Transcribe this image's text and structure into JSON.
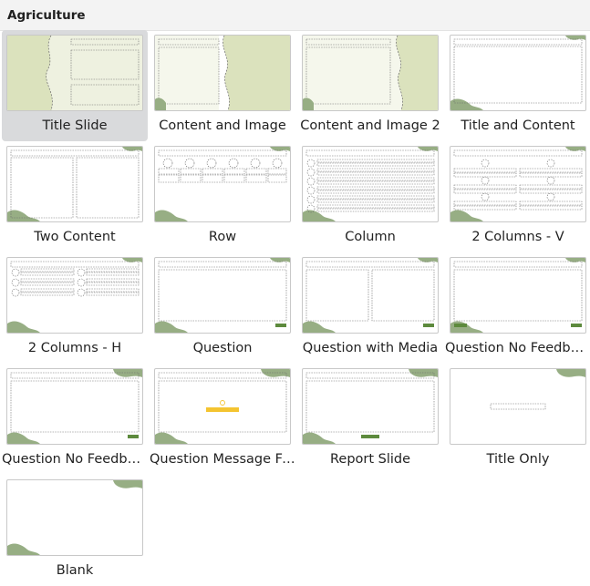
{
  "header": {
    "title": "Agriculture"
  },
  "colors": {
    "accent_green": "#97ae84",
    "pale_green": "#dbe2bd",
    "dark_green": "#5d8a3d",
    "highlight_yellow": "#f4c430",
    "selected_bg": "#d9dadc"
  },
  "layouts": [
    {
      "label": "Title Slide",
      "selected": true
    },
    {
      "label": "Content and Image",
      "selected": false
    },
    {
      "label": "Content and Image 2",
      "selected": false
    },
    {
      "label": "Title and Content",
      "selected": false
    },
    {
      "label": "Two Content",
      "selected": false
    },
    {
      "label": "Row",
      "selected": false
    },
    {
      "label": "Column",
      "selected": false
    },
    {
      "label": "2 Columns - V",
      "selected": false
    },
    {
      "label": "2 Columns - H",
      "selected": false
    },
    {
      "label": "Question",
      "selected": false
    },
    {
      "label": "Question with Media",
      "selected": false
    },
    {
      "label": "Question No Feedba…",
      "selected": false
    },
    {
      "label": "Question No Feedba…",
      "selected": false
    },
    {
      "label": "Question Message Fe…",
      "selected": false
    },
    {
      "label": "Report Slide",
      "selected": false
    },
    {
      "label": "Title Only",
      "selected": false
    },
    {
      "label": "Blank",
      "selected": false
    }
  ]
}
